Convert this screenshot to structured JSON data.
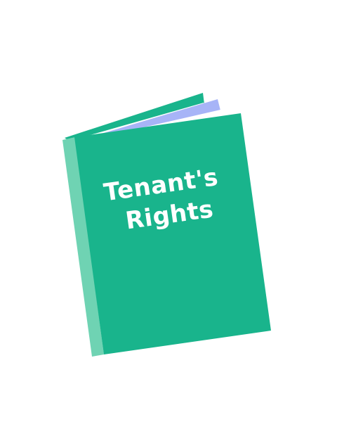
{
  "book": {
    "title_line1": "Tenant's",
    "title_line2": "Rights",
    "colors": {
      "cover": "#19b48c",
      "spine": "#6fd3b3",
      "back_cover": "#19b48c",
      "page_edge": "#a7b4f7",
      "page_white": "#ffffff",
      "title_text": "#ffffff"
    }
  }
}
